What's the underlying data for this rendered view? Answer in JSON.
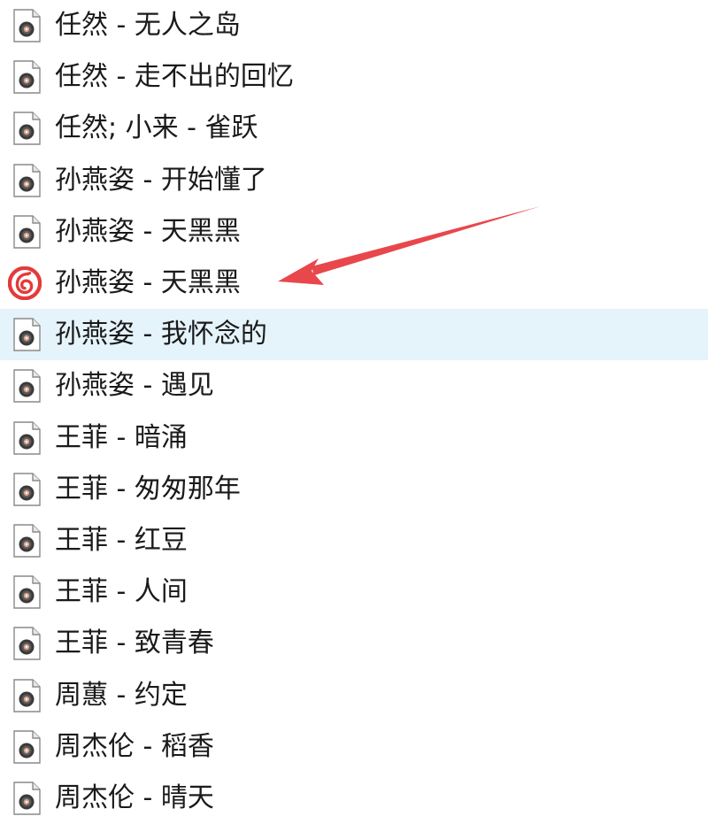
{
  "files": [
    {
      "name": "任然 - 无人之岛",
      "icon": "audio-file-icon"
    },
    {
      "name": "任然 - 走不出的回忆",
      "icon": "audio-file-icon"
    },
    {
      "name": "任然; 小来 - 雀跃",
      "icon": "audio-file-icon"
    },
    {
      "name": "孙燕姿 - 开始懂了",
      "icon": "audio-file-icon"
    },
    {
      "name": "孙燕姿 - 天黑黑",
      "icon": "audio-file-icon"
    },
    {
      "name": "孙燕姿 - 天黑黑",
      "icon": "netease-music-icon"
    },
    {
      "name": "孙燕姿 - 我怀念的",
      "icon": "audio-file-icon",
      "selected": true
    },
    {
      "name": "孙燕姿 - 遇见",
      "icon": "audio-file-icon"
    },
    {
      "name": "王菲 - 暗涌",
      "icon": "audio-file-icon"
    },
    {
      "name": "王菲 - 匆匆那年",
      "icon": "audio-file-icon"
    },
    {
      "name": "王菲 - 红豆",
      "icon": "audio-file-icon"
    },
    {
      "name": "王菲 - 人间",
      "icon": "audio-file-icon"
    },
    {
      "name": "王菲 - 致青春",
      "icon": "audio-file-icon"
    },
    {
      "name": "周蕙 - 约定",
      "icon": "audio-file-icon"
    },
    {
      "name": "周杰伦 - 稻香",
      "icon": "audio-file-icon"
    },
    {
      "name": "周杰伦 - 晴天",
      "icon": "audio-file-icon"
    }
  ],
  "colors": {
    "selection": "#e5f3fb",
    "annotation_arrow": "#e8474c",
    "netease_red": "#e33b3b"
  }
}
